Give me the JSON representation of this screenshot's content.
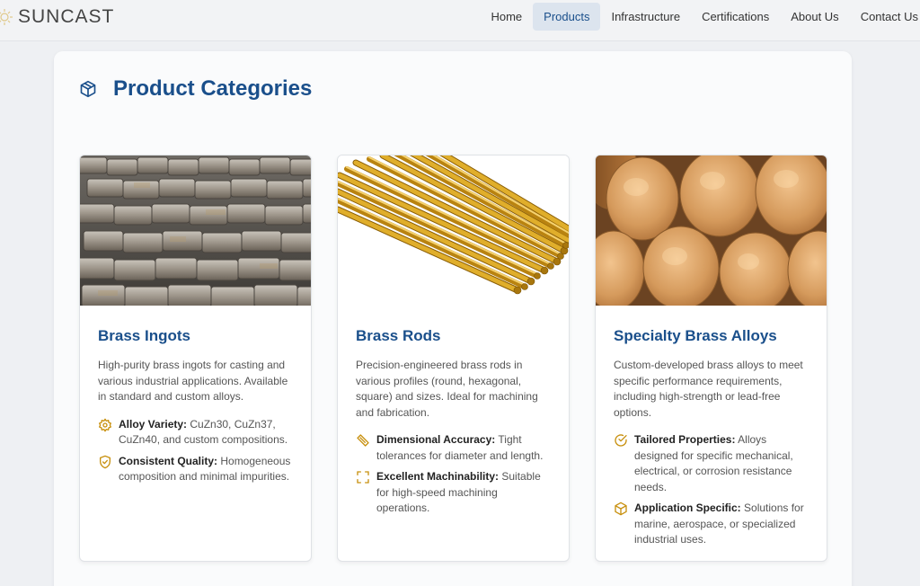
{
  "brand": {
    "name": "SUNCAST"
  },
  "nav": {
    "items": [
      {
        "label": "Home",
        "active": false
      },
      {
        "label": "Products",
        "active": true
      },
      {
        "label": "Infrastructure",
        "active": false
      },
      {
        "label": "Certifications",
        "active": false
      },
      {
        "label": "About Us",
        "active": false
      },
      {
        "label": "Contact Us",
        "active": false
      }
    ]
  },
  "section": {
    "title": "Product Categories",
    "icon": "cube-icon"
  },
  "colors": {
    "accent": "#1a4f8b",
    "icon_gold": "#c8900e",
    "nav_active_bg": "#dce4ee"
  },
  "cards": [
    {
      "title": "Brass Ingots",
      "image": "brass-ingots-photo",
      "description": "High-purity brass ingots for casting and various industrial applications. Available in standard and custom alloys.",
      "features": [
        {
          "icon": "gear-icon",
          "label": "Alloy Variety:",
          "text": " CuZn30, CuZn37, CuZn40, and custom compositions."
        },
        {
          "icon": "shield-check-icon",
          "label": "Consistent Quality:",
          "text": " Homogeneous composition and minimal impurities."
        }
      ]
    },
    {
      "title": "Brass Rods",
      "image": "brass-rods-photo",
      "description": "Precision-engineered brass rods in various profiles (round, hexagonal, square) and sizes. Ideal for machining and fabrication.",
      "features": [
        {
          "icon": "ruler-icon",
          "label": "Dimensional Accuracy:",
          "text": " Tight tolerances for diameter and length."
        },
        {
          "icon": "crop-frame-icon",
          "label": "Excellent Machinability:",
          "text": " Suitable for high-speed machining operations."
        }
      ]
    },
    {
      "title": "Specialty Brass Alloys",
      "image": "brass-billets-photo",
      "description": "Custom-developed brass alloys to meet specific performance requirements, including high-strength or lead-free options.",
      "features": [
        {
          "icon": "check-circle-icon",
          "label": "Tailored Properties:",
          "text": " Alloys designed for specific mechanical, electrical, or corrosion resistance needs."
        },
        {
          "icon": "box-icon",
          "label": "Application Specific:",
          "text": " Solutions for marine, aerospace, or specialized industrial uses."
        }
      ]
    }
  ]
}
